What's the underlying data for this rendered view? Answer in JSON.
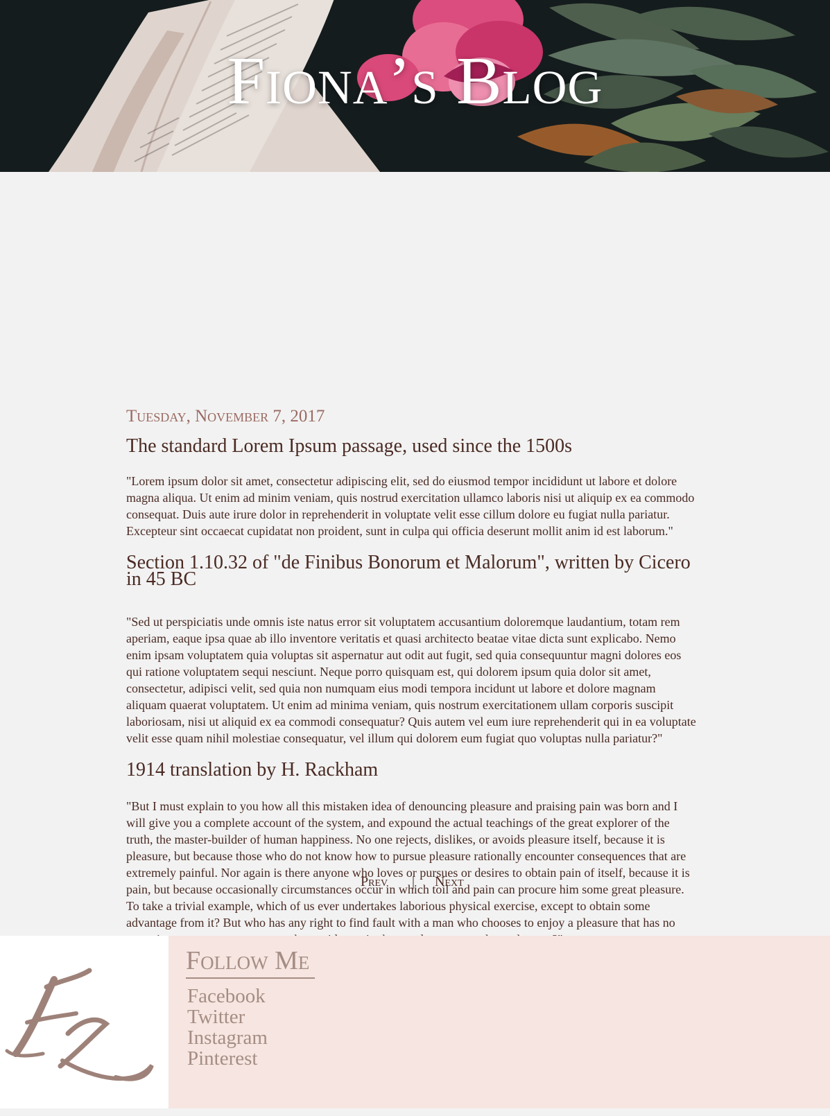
{
  "header": {
    "title": "Fiona’s Blog"
  },
  "post": {
    "date": "Tuesday, November 7, 2017",
    "sections": [
      {
        "heading": "The standard Lorem Ipsum passage, used since the 1500s",
        "body": "\"Lorem ipsum dolor sit amet, consectetur adipiscing elit, sed do eiusmod tempor incididunt ut labore et dolore magna aliqua. Ut enim ad minim veniam, quis nostrud exercitation ullamco laboris nisi ut aliquip ex ea commodo consequat. Duis aute irure dolor in reprehenderit in voluptate velit esse cillum dolore eu fugiat nulla pariatur. Excepteur sint occaecat cupidatat non proident, sunt in culpa qui officia deserunt mollit anim id est laborum.\""
      },
      {
        "heading": "Section 1.10.32 of \"de Finibus Bonorum et Malorum\", written by Cicero in 45 BC",
        "body": "\"Sed ut perspiciatis unde omnis iste natus error sit voluptatem accusantium doloremque laudantium, totam rem aperiam, eaque ipsa quae ab illo inventore veritatis et quasi architecto beatae vitae dicta sunt explicabo. Nemo enim ipsam voluptatem quia voluptas sit aspernatur aut odit aut fugit, sed quia consequuntur magni dolores eos qui ratione voluptatem sequi nesciunt. Neque porro quisquam est, qui dolorem ipsum quia dolor sit amet, consectetur, adipisci velit, sed quia non numquam eius modi tempora incidunt ut labore et dolore magnam aliquam quaerat voluptatem. Ut enim ad minima veniam, quis nostrum exercitationem ullam corporis suscipit laboriosam, nisi ut aliquid ex ea commodi consequatur? Quis autem vel eum iure reprehenderit qui in ea voluptate velit esse quam nihil molestiae consequatur, vel illum qui dolorem eum fugiat quo voluptas nulla pariatur?\""
      },
      {
        "heading": "1914 translation by H. Rackham",
        "body": "\"But I must explain to you how all this mistaken idea of denouncing pleasure and praising pain was born and I will give you a complete account of the system, and expound the actual teachings of the great explorer of the truth, the master-builder of human happiness. No one rejects, dislikes, or avoids pleasure itself, because it is pleasure, but because those who do not know how to pursue pleasure rationally encounter consequences that are extremely painful. Nor again is there anyone who loves or pursues or desires to obtain pain of itself, because it is pain, but because occasionally circumstances occur in which toil and pain can procure him some great pleasure. To take a trivial example, which of us ever undertakes laborious physical exercise, except to obtain some advantage from it? But who has any right to find fault with a man who chooses to enjoy a pleasure that has no annoying consequences, or one who avoids a pain that produces no resultant pleasure?\""
      }
    ]
  },
  "pager": {
    "prev": "Prev",
    "separator": "|",
    "next": "Next"
  },
  "footer": {
    "logo_text": "FZ",
    "follow_title": "Follow Me",
    "links": [
      "Facebook",
      "Twitter",
      "Instagram",
      "Pinterest"
    ]
  },
  "colors": {
    "page_background": "#f2f2f2",
    "text": "#4a2a23",
    "date_accent": "#9a6a61",
    "footer_panel": "#f6e5e0",
    "footer_text": "#a58d84",
    "header_background": "#151c1d"
  },
  "icons": {
    "header_image": "book-and-flowers-image",
    "logo": "fz-monogram-logo"
  }
}
